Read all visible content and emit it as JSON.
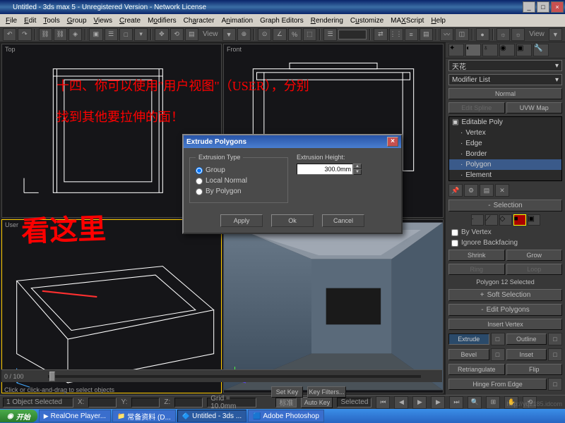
{
  "window": {
    "title": "Untitled - 3ds max 5 - Unregistered Version - Network License"
  },
  "menus": [
    "File",
    "Edit",
    "Tools",
    "Group",
    "Views",
    "Create",
    "Modifiers",
    "Character",
    "Animation",
    "Graph Editors",
    "Rendering",
    "Customize",
    "MAXScript",
    "Help"
  ],
  "toolbar": {
    "view_label": "View",
    "view2_label": "View"
  },
  "viewports": {
    "top": "Top",
    "front": "Front",
    "user": "User",
    "persp": ""
  },
  "slider": {
    "frame": "0 / 100"
  },
  "panel": {
    "dropdown_top": "天花",
    "modifier_list": "Modifier List",
    "btn_normal": "Normal",
    "btn_editspline": "Edit Spline",
    "btn_uvwmap": "UVW Map",
    "stack": [
      "Editable Poly",
      "Vertex",
      "Edge",
      "Border",
      "Polygon",
      "Element"
    ],
    "rollout_selection": "Selection",
    "cb_byvertex": "By Vertex",
    "cb_ignore": "Ignore Backfacing",
    "btn_shrink": "Shrink",
    "btn_grow": "Grow",
    "btn_ring": "Ring",
    "btn_loop": "Loop",
    "sel_status": "Polygon 12 Selected",
    "rollout_soft": "Soft Selection",
    "rollout_edit": "Edit Polygons",
    "btn_insertvertex": "Insert Vertex",
    "btn_extrude": "Extrude",
    "btn_outline": "Outline",
    "btn_bevel": "Bevel",
    "btn_inset": "Inset",
    "btn_retri": "Retriangulate",
    "btn_flip": "Flip",
    "btn_hinge": "Hinge From Edge"
  },
  "dialog": {
    "title": "Extrude Polygons",
    "extrusion_type": "Extrusion Type",
    "r_group": "Group",
    "r_local": "Local Normal",
    "r_polygon": "By Polygon",
    "extrusion_height": "Extrusion Height:",
    "height_value": "300.0mm",
    "apply": "Apply",
    "ok": "Ok",
    "cancel": "Cancel"
  },
  "status": {
    "selected": "1 Object Selected",
    "x": "X:",
    "y": "Y:",
    "z": "Z:",
    "grid": "Grid = 10.0mm",
    "autokey": "Auto Key",
    "selected2": "Selected",
    "setkey": "Set Key",
    "keyfilters": "Key Filters...",
    "biaozhun": "标准",
    "prompt": "Click or click-and-drag to select objects"
  },
  "taskbar": {
    "start": "开始",
    "tasks": [
      "RealOne Player...",
      "常备资料 (D...",
      "Untitled - 3ds ...",
      "Adobe Photoshop"
    ]
  },
  "annotations": {
    "line1": "十四、你可以使用\"用户视图\"（USER），分别",
    "line2": "找到其他要拉伸的面！",
    "look": "看这里"
  },
  "watermark": "http://yq2185.idcom"
}
